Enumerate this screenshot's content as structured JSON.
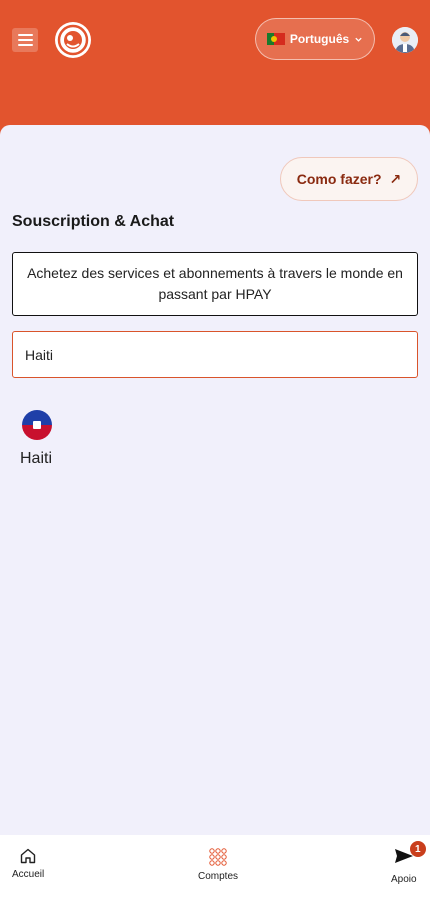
{
  "header": {
    "language_label": "Português"
  },
  "help": {
    "how_to_label": "Como fazer?",
    "arrow": "↗"
  },
  "main": {
    "title": "Souscription & Achat",
    "description": "Achetez des services et abonnements à travers le monde en passant par HPAY",
    "search_value": "Haiti",
    "countries": [
      {
        "name": "Haiti",
        "flag_icon": "haiti-flag-icon"
      }
    ]
  },
  "bottom_nav": [
    {
      "label": "Accueil",
      "icon": "home-icon"
    },
    {
      "label": "Comptes",
      "icon": "grid-icon"
    },
    {
      "label": "Apoio",
      "icon": "send-icon",
      "badge": "1"
    }
  ],
  "colors": {
    "brand": "#e2542e",
    "background": "#f1f0fb"
  }
}
